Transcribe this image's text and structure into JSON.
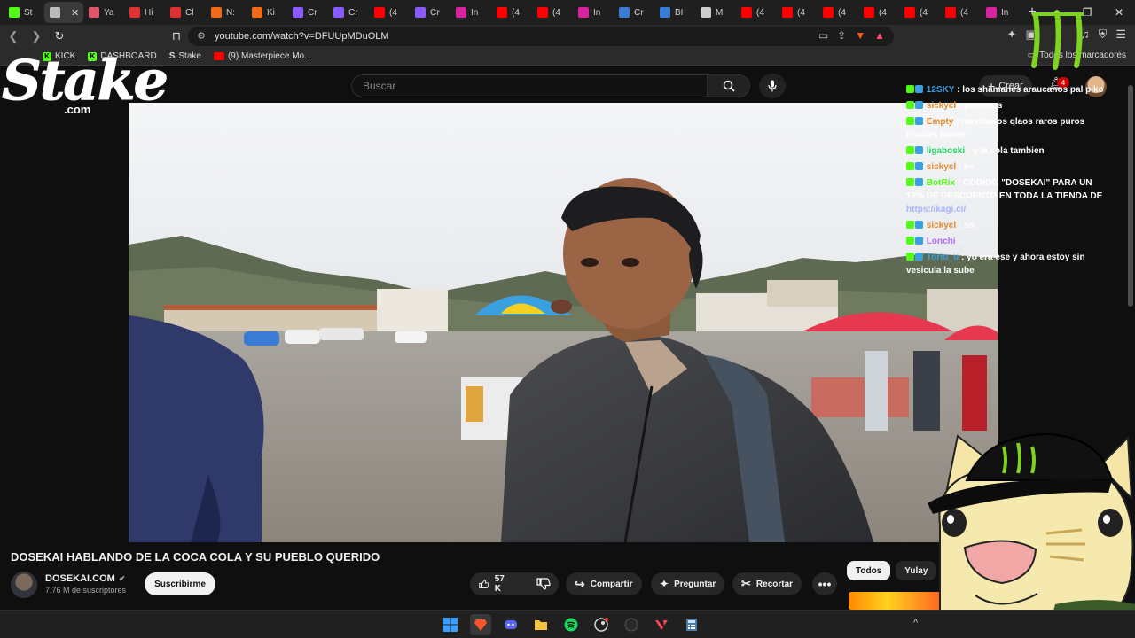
{
  "browser": {
    "tabs": [
      {
        "label": "St",
        "favicon_color": "#53fc18",
        "active": false
      },
      {
        "label": "",
        "favicon_color": "#bbbbbb",
        "active": true
      },
      {
        "label": "Ya",
        "favicon_color": "#e0566b",
        "active": false
      },
      {
        "label": "Hi",
        "favicon_color": "#e03030",
        "active": false
      },
      {
        "label": "Cl",
        "favicon_color": "#e03030",
        "active": false
      },
      {
        "label": "N:",
        "favicon_color": "#f06a1a",
        "active": false
      },
      {
        "label": "Ki",
        "favicon_color": "#f06a1a",
        "active": false
      },
      {
        "label": "Cr",
        "favicon_color": "#8a5cff",
        "active": false
      },
      {
        "label": "Cr",
        "favicon_color": "#8a5cff",
        "active": false
      },
      {
        "label": "(4",
        "favicon_color": "#ff0000",
        "active": false
      },
      {
        "label": "Cr",
        "favicon_color": "#8a5cff",
        "active": false
      },
      {
        "label": "In",
        "favicon_color": "#d6249f",
        "active": false
      },
      {
        "label": "(4",
        "favicon_color": "#ff0000",
        "active": false
      },
      {
        "label": "(4",
        "favicon_color": "#ff0000",
        "active": false
      },
      {
        "label": "In",
        "favicon_color": "#d6249f",
        "active": false
      },
      {
        "label": "Cr",
        "favicon_color": "#3a7bd5",
        "active": false
      },
      {
        "label": "BI",
        "favicon_color": "#3a7bd5",
        "active": false
      },
      {
        "label": "M",
        "favicon_color": "#cccccc",
        "active": false
      },
      {
        "label": "(4",
        "favicon_color": "#ff0000",
        "active": false
      },
      {
        "label": "(4",
        "favicon_color": "#ff0000",
        "active": false
      },
      {
        "label": "(4",
        "favicon_color": "#ff0000",
        "active": false
      },
      {
        "label": "(4",
        "favicon_color": "#ff0000",
        "active": false
      },
      {
        "label": "(4",
        "favicon_color": "#ff0000",
        "active": false
      },
      {
        "label": "(4",
        "favicon_color": "#ff0000",
        "active": false
      },
      {
        "label": "In",
        "favicon_color": "#d6249f",
        "active": false
      }
    ],
    "url": "youtube.com/watch?v=DFUUpMDuOLM",
    "bookmarks": [
      {
        "label": "KICK",
        "icon": "kick-icon"
      },
      {
        "label": "DASHBOARD",
        "icon": "kick-icon"
      },
      {
        "label": "Stake",
        "icon": "stake-icon"
      },
      {
        "label": "(9) Masterpiece Mo...",
        "icon": "youtube-icon"
      }
    ],
    "all_bookmarks_label": "Todos los marcadores"
  },
  "youtube": {
    "search_placeholder": "Buscar",
    "create_label": "Crear",
    "notification_count": "4",
    "video_title": "DOSEKAI HABLANDO DE LA COCA COLA Y SU PUEBLO QUERIDO",
    "channel_name": "DOSEKAI.COM",
    "subscribers": "7,76 M de suscriptores",
    "subscribe_label": "Suscribirme",
    "likes": "57 K",
    "share_label": "Compartir",
    "ask_label": "Preguntar",
    "clip_label": "Recortar",
    "chips": [
      "Todos",
      "Yulay"
    ]
  },
  "overlay": {
    "stake_logo": "Stake",
    "stake_logo_suffix": ".com",
    "chat": [
      {
        "user": "12SKY",
        "user_color": "#3aa0e0",
        "text": "los shamanes araucanos pal piko"
      },
      {
        "user": "sickycl",
        "user_color": "#e88a2a",
        "text": "perrunos"
      },
      {
        "user": "Empty",
        "user_color": "#e88a2a",
        "text": "mexicanos qlaos raros puros rituales hacen"
      },
      {
        "user": "ligaboski",
        "user_color": "#2bd46a",
        "text": "y la cola tambien"
      },
      {
        "user": "sickycl",
        "user_color": "#e88a2a",
        "text": "ke"
      },
      {
        "user": "BotRix",
        "user_color": "#53fc18",
        "text": "CODIGO \"DOSEKAI\" PARA UN 12% DE DESCUENTO EN TODA LA TIENDA DE",
        "link": "https://kagi.cl/"
      },
      {
        "user": "sickycl",
        "user_color": "#e88a2a",
        "text": "so"
      },
      {
        "user": "Lonchi",
        "user_color": "#b26bff",
        "text": ""
      },
      {
        "user": "Tortu_u",
        "user_color": "#3aa0e0",
        "text": "yo era ese y ahora estoy sin vesicula la sube"
      }
    ]
  },
  "taskbar": {
    "icons": [
      "windows-start-icon",
      "brave-icon",
      "discord-icon",
      "file-explorer-icon",
      "spotify-icon",
      "steam-icon",
      "obs-icon",
      "valorant-icon",
      "calculator-icon"
    ],
    "tray_chevron": "^"
  }
}
